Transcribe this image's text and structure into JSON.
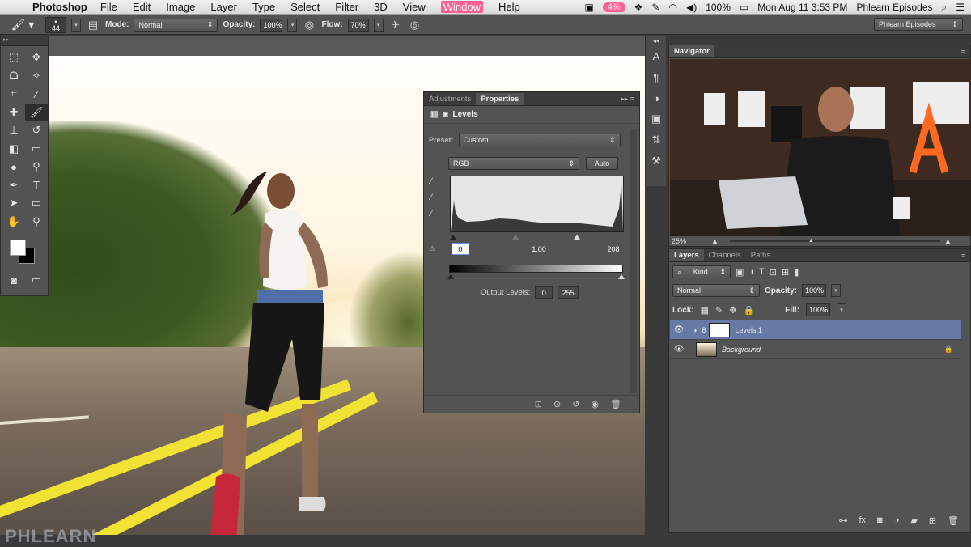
{
  "menubar": {
    "app_name": "Photoshop",
    "items": [
      "File",
      "Edit",
      "Image",
      "Layer",
      "Type",
      "Select",
      "Filter",
      "3D",
      "View",
      "Window",
      "Help"
    ],
    "highlighted": "Window",
    "status": {
      "recording": "4%",
      "battery": "100%",
      "clock": "Mon Aug 11  3:53 PM",
      "user": "Phlearn Episodes"
    }
  },
  "options_bar": {
    "brush_size": "44",
    "mode_label": "Mode:",
    "mode_value": "Normal",
    "opacity_label": "Opacity:",
    "opacity_value": "100%",
    "flow_label": "Flow:",
    "flow_value": "70%",
    "workspace": "Phlearn Episodes"
  },
  "tools": [
    "marquee",
    "move",
    "lasso",
    "quick-select",
    "crop",
    "eyedropper",
    "healing",
    "brush",
    "stamp",
    "history-brush",
    "eraser",
    "gradient",
    "blur",
    "dodge",
    "pen",
    "type",
    "path-select",
    "shape",
    "hand",
    "zoom"
  ],
  "properties": {
    "tabs": [
      "Adjustments",
      "Properties"
    ],
    "active_tab": "Properties",
    "title": "Levels",
    "preset_label": "Preset:",
    "preset_value": "Custom",
    "channel_value": "RGB",
    "auto_label": "Auto",
    "input_black": "0",
    "input_gamma": "1.00",
    "input_white": "208",
    "output_label": "Output Levels:",
    "output_black": "0",
    "output_white": "255"
  },
  "navigator": {
    "tab": "Navigator",
    "zoom": "25%"
  },
  "layers_panel": {
    "tabs": [
      "Layers",
      "Channels",
      "Paths"
    ],
    "active_tab": "Layers",
    "filter_kind": "Kind",
    "blend_mode": "Normal",
    "opacity_label": "Opacity:",
    "opacity_value": "100%",
    "lock_label": "Lock:",
    "fill_label": "Fill:",
    "fill_value": "100%",
    "layers": [
      {
        "name": "Levels 1",
        "selected": true
      },
      {
        "name": "Background",
        "selected": false
      }
    ]
  },
  "watermark": "PHLEARN",
  "colors": {
    "highlight_pink": "#ff5f93",
    "panel_bg": "#535353",
    "selected_layer": "#6779a5"
  }
}
